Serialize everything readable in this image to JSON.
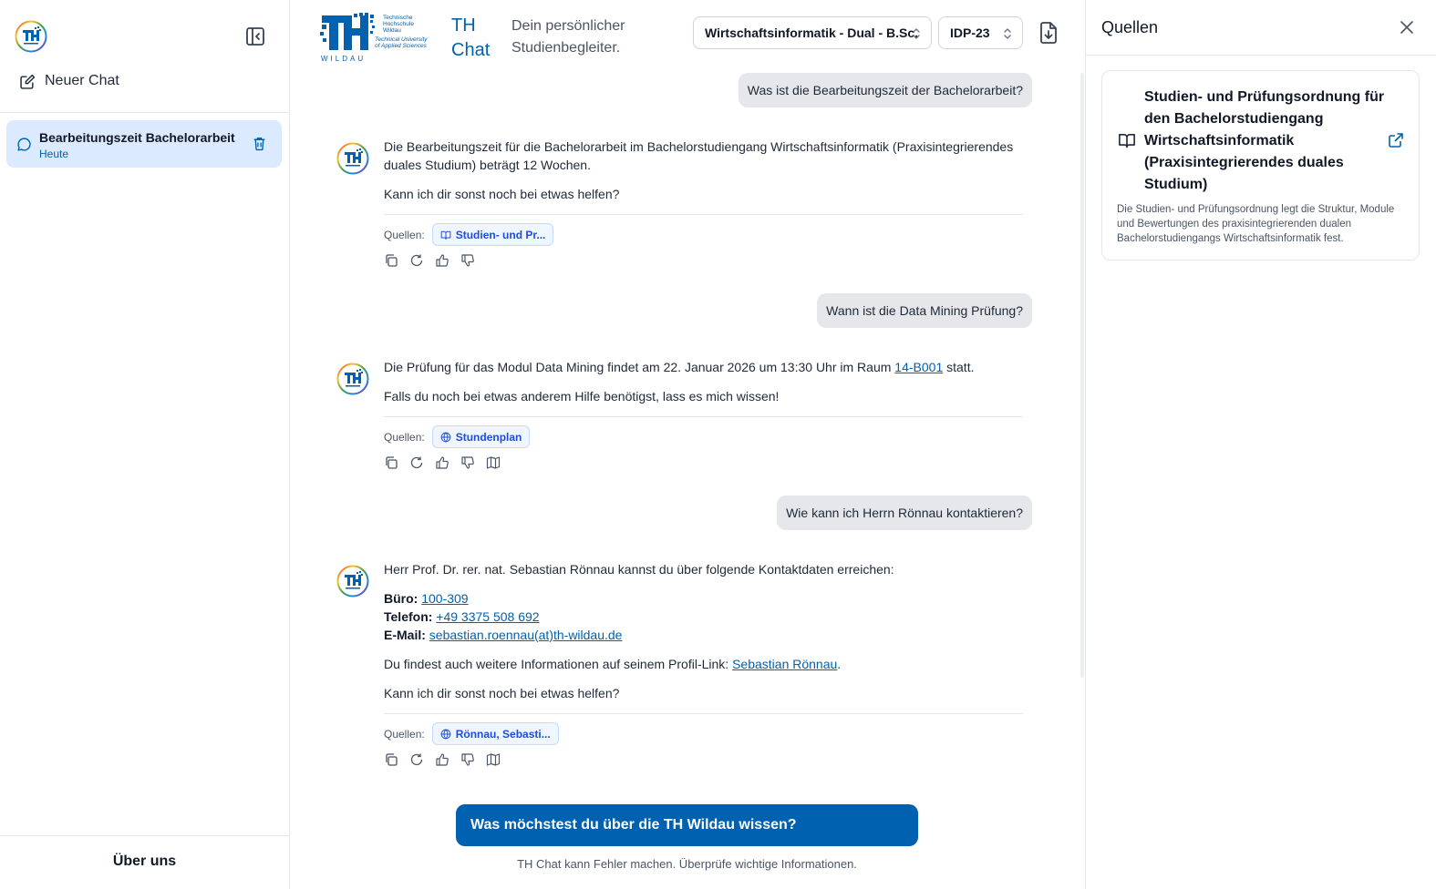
{
  "sidebar": {
    "new_chat_label": "Neuer Chat",
    "chats": [
      {
        "title": "Bearbeitungszeit Bachelorarbeit",
        "date": "Heute"
      }
    ],
    "about_label": "Über uns"
  },
  "header": {
    "logo_text": [
      "Technische",
      "Hochschule",
      "Wildau",
      "Technical University",
      "of Applied Sciences",
      "WILDAU"
    ],
    "brand_line1": "TH",
    "brand_line2": "Chat",
    "tagline_line1": "Dein persönlicher",
    "tagline_line2": "Studienbegleiter.",
    "program_select": "Wirtschaftsinformatik - Dual - B.Sc.",
    "po_select": "IDP-23"
  },
  "conversation": {
    "sources_label": "Quellen:",
    "q1": "Was ist die Bearbeitungszeit der Bachelorarbeit?",
    "a1_p1": "Die Bearbeitungszeit für die Bachelorarbeit im Bachelorstudiengang Wirtschaftsinformatik (Praxisintegrierendes duales Studium) beträgt 12 Wochen.",
    "a1_p2": "Kann ich dir sonst noch bei etwas helfen?",
    "a1_source": "Studien- und Pr...",
    "q2": "Wann ist die Data Mining Prüfung?",
    "a2_p1_pre": "Die Prüfung für das Modul Data Mining findet am 22. Januar 2026 um 13:30 Uhr im Raum ",
    "a2_p1_link": "14-B001",
    "a2_p1_post": " statt.",
    "a2_p2": "Falls du noch bei etwas anderem Hilfe benötigst, lass es mich wissen!",
    "a2_source": "Stundenplan",
    "q3": "Wie kann ich Herrn Rönnau kontaktieren?",
    "a3_p1": "Herr Prof. Dr. rer. nat. Sebastian Rönnau kannst du über folgende Kontaktdaten erreichen:",
    "a3_office_label": "Büro:",
    "a3_office": "100-309",
    "a3_phone_label": "Telefon:",
    "a3_phone": "+49 3375 508 692",
    "a3_email_label": "E-Mail:",
    "a3_email": "sebastian.roennau(at)th-wildau.de",
    "a3_p3_pre": "Du findest auch weitere Informationen auf seinem Profil-Link: ",
    "a3_p3_link": "Sebastian Rönnau",
    "a3_p3_post": ".",
    "a3_p4": "Kann ich dir sonst noch bei etwas helfen?",
    "a3_source": "Rönnau, Sebasti..."
  },
  "composer": {
    "ask_label": "Was möchstest du über die TH Wildau wissen?",
    "disclaimer": "TH Chat kann Fehler machen. Überprüfe wichtige Informationen."
  },
  "sources_panel": {
    "title": "Quellen",
    "card_title": "Studien- und Prüfungsordnung für den Bachelorstudiengang Wirtschaftsinformatik (Praxisintegrierendes duales Studium)",
    "card_desc": "Die Studien- und Prüfungsordnung legt die Struktur, Module und Bewertungen des praxisintegrierenden dualen Bachelorstudiengangs Wirtschaftsinformatik fest."
  },
  "colors": {
    "brand_blue": "#0061b0",
    "chip_blue": "#1d4ed8",
    "selected_bg": "#dbeafe",
    "bubble_bg": "#e5e7eb"
  }
}
